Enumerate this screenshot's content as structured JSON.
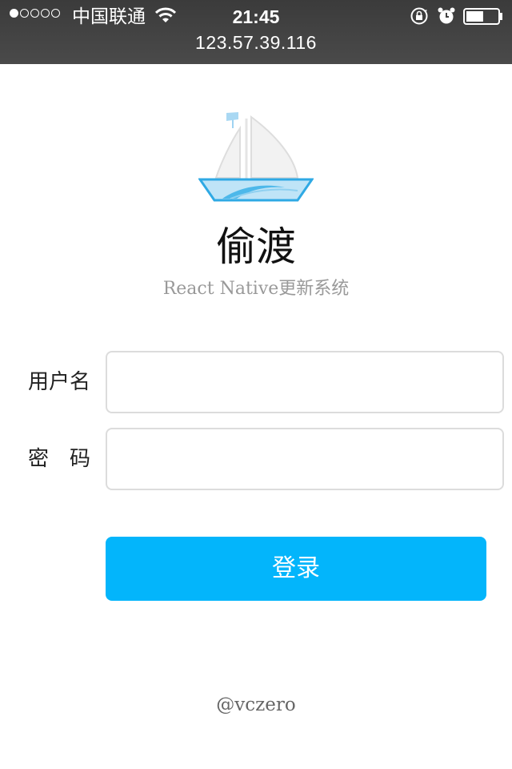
{
  "status_bar": {
    "signal_dots": [
      true,
      false,
      false,
      false,
      false
    ],
    "carrier": "中国联通",
    "time": "21:45",
    "url": "123.57.39.116",
    "icons": [
      "wifi-icon",
      "rotation-lock-icon",
      "alarm-icon",
      "battery-icon"
    ],
    "battery_level": 0.55
  },
  "header": {
    "logo": "sailboat-icon",
    "title": "偷渡",
    "subtitle": "React Native更新系统"
  },
  "form": {
    "username_label": "用户名",
    "password_label": "密　码",
    "username_value": "",
    "password_value": "",
    "username_placeholder": "",
    "password_placeholder": "",
    "login_label": "登录"
  },
  "footer": {
    "credit": "@vczero"
  },
  "colors": {
    "accent": "#03b5fb",
    "status_bar_bg": "#404040",
    "input_border": "#dcdcdc",
    "subtitle": "#999999"
  }
}
